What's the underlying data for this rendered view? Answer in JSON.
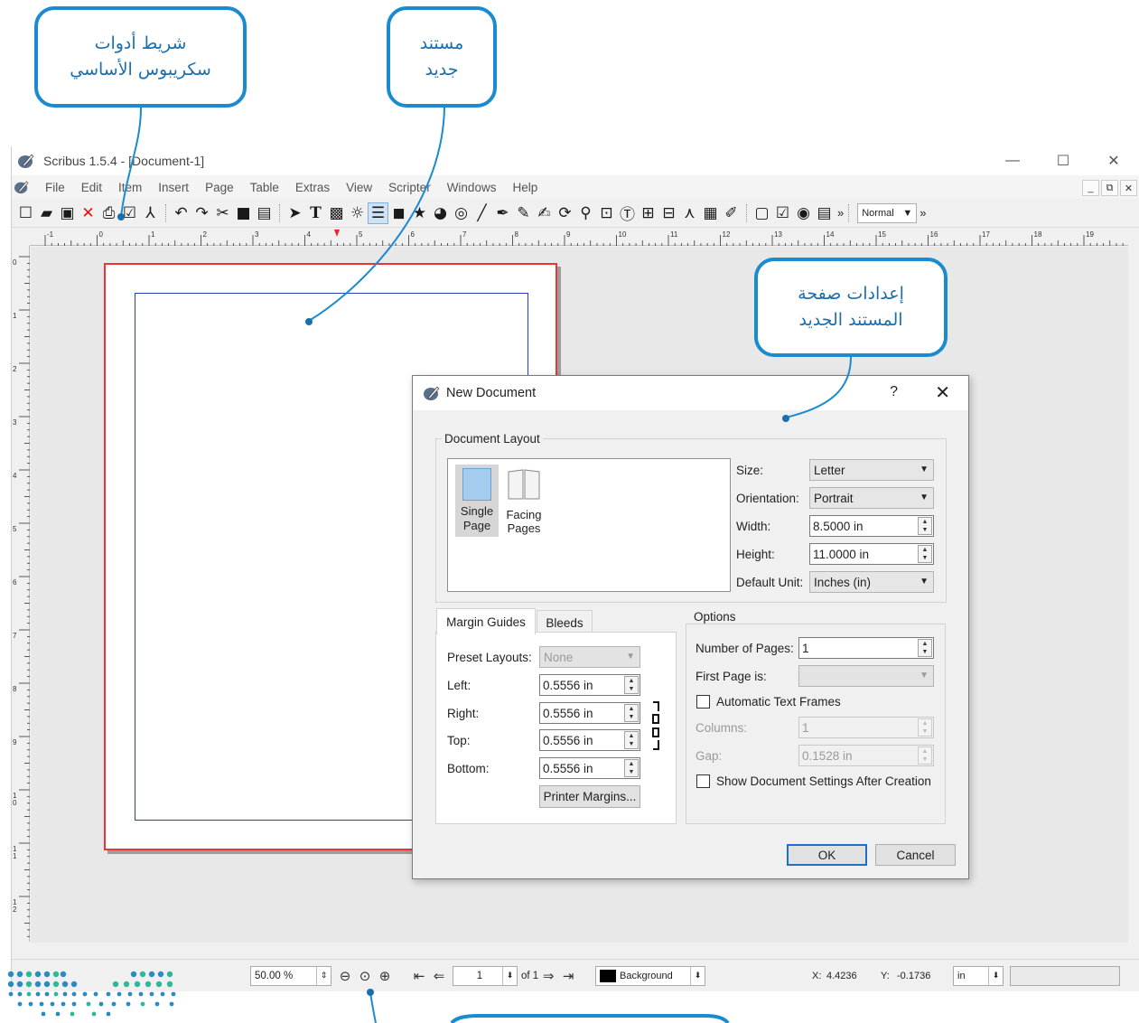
{
  "callouts": {
    "toolbar": [
      "شريط أدوات",
      "سكريبوس الأساسي"
    ],
    "new_document": [
      "مستند",
      "جديد"
    ],
    "page_settings": [
      "إعدادات صفحة",
      "المستند الجديد"
    ]
  },
  "window": {
    "title": "Scribus 1.5.4 - [Document-1]",
    "controls": {
      "minimize": "—",
      "maximize": "☐",
      "close": "✕"
    }
  },
  "menu": [
    "File",
    "Edit",
    "Item",
    "Insert",
    "Page",
    "Table",
    "Extras",
    "View",
    "Scripter",
    "Windows",
    "Help"
  ],
  "toolbar": {
    "mode_select": "Normal",
    "more": "»"
  },
  "ruler": {
    "h_labels": [
      "-1",
      "0",
      "1",
      "2",
      "3",
      "4",
      "5",
      "6",
      "7",
      "8",
      "9",
      "10",
      "11",
      "12",
      "13",
      "14",
      "15",
      "16",
      "17",
      "18",
      "19"
    ],
    "v_labels": [
      "0",
      "1",
      "2",
      "3",
      "4",
      "5",
      "6",
      "7",
      "8",
      "9",
      "10",
      "11",
      "12"
    ]
  },
  "statusbar": {
    "zoom": "50.00 %",
    "page_number": "1",
    "page_of": "of 1",
    "layer": "Background",
    "x_label": "X:",
    "x_value": "4.4236",
    "y_label": "Y:",
    "y_value": "-0.1736",
    "unit": "in"
  },
  "dialog": {
    "title": "New Document",
    "help": "?",
    "close": "✕",
    "document_layout": {
      "label": "Document Layout",
      "single_page": [
        "Single",
        "Page"
      ],
      "facing_pages": [
        "Facing",
        "Pages"
      ],
      "size_label": "Size:",
      "size": "Letter",
      "orientation_label": "Orientation:",
      "orientation": "Portrait",
      "width_label": "Width:",
      "width": "8.5000 in",
      "height_label": "Height:",
      "height": "11.0000 in",
      "unit_label": "Default Unit:",
      "unit": "Inches (in)"
    },
    "tabs": {
      "margin_guides": "Margin Guides",
      "bleeds": "Bleeds"
    },
    "margins": {
      "preset_label": "Preset Layouts:",
      "preset": "None",
      "left_label": "Left:",
      "left": "0.5556 in",
      "right_label": "Right:",
      "right": "0.5556 in",
      "top_label": "Top:",
      "top": "0.5556 in",
      "bottom_label": "Bottom:",
      "bottom": "0.5556 in",
      "printer_margins": "Printer Margins..."
    },
    "options": {
      "label": "Options",
      "pages_label": "Number of Pages:",
      "pages": "1",
      "first_page_label": "First Page is:",
      "auto_text_frames": "Automatic Text Frames",
      "columns_label": "Columns:",
      "columns": "1",
      "gap_label": "Gap:",
      "gap": "0.1528 in",
      "show_settings": "Show Document Settings After Creation"
    },
    "ok": "OK",
    "cancel": "Cancel"
  }
}
